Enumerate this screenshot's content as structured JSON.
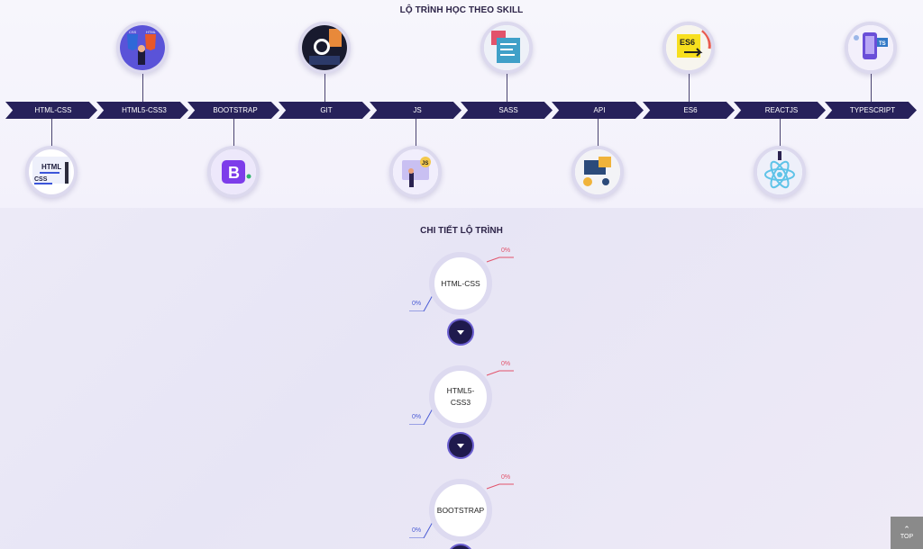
{
  "roadmap": {
    "title": "LỘ TRÌNH HỌC THEO SKILL",
    "skills": [
      {
        "label": "HTML-CSS",
        "icon": "html-css-illustration-icon",
        "bubble": "below"
      },
      {
        "label": "HTML5-CSS3",
        "icon": "html5-css3-illustration-icon",
        "bubble": "above"
      },
      {
        "label": "BOOTSTRAP",
        "icon": "bootstrap-logo-icon",
        "bubble": "below"
      },
      {
        "label": "GIT",
        "icon": "github-illustration-icon",
        "bubble": "above"
      },
      {
        "label": "JS",
        "icon": "javascript-illustration-icon",
        "bubble": "below"
      },
      {
        "label": "SASS",
        "icon": "sass-illustration-icon",
        "bubble": "above"
      },
      {
        "label": "API",
        "icon": "api-illustration-icon",
        "bubble": "below"
      },
      {
        "label": "ES6",
        "icon": "es6-illustration-icon",
        "bubble": "above"
      },
      {
        "label": "REACTJS",
        "icon": "react-logo-icon",
        "bubble": "below"
      },
      {
        "label": "TYPESCRIPT",
        "icon": "typescript-illustration-icon",
        "bubble": "above"
      }
    ],
    "icon_text": {
      "html": "HTML",
      "css": "CSS",
      "html5_css": "CSS",
      "html5_html": "HTML",
      "bootstrap": "B",
      "js": "JS",
      "es6": "ES6",
      "ts": "TS"
    }
  },
  "detail": {
    "title": "CHI TIẾT LỘ TRÌNH",
    "items": [
      {
        "name": "HTML-CSS",
        "progress_top": "0%",
        "progress_bottom": "0%"
      },
      {
        "name": "HTML5-\nCSS3",
        "progress_top": "0%",
        "progress_bottom": "0%"
      },
      {
        "name": "BOOTSTRAP",
        "progress_top": "0%",
        "progress_bottom": "0%"
      }
    ]
  },
  "top_button": {
    "label": "TOP"
  },
  "colors": {
    "chevron": "#27215a",
    "accent_red": "#e2536b",
    "accent_blue": "#4a5bd4",
    "button": "#1f1a4d"
  }
}
